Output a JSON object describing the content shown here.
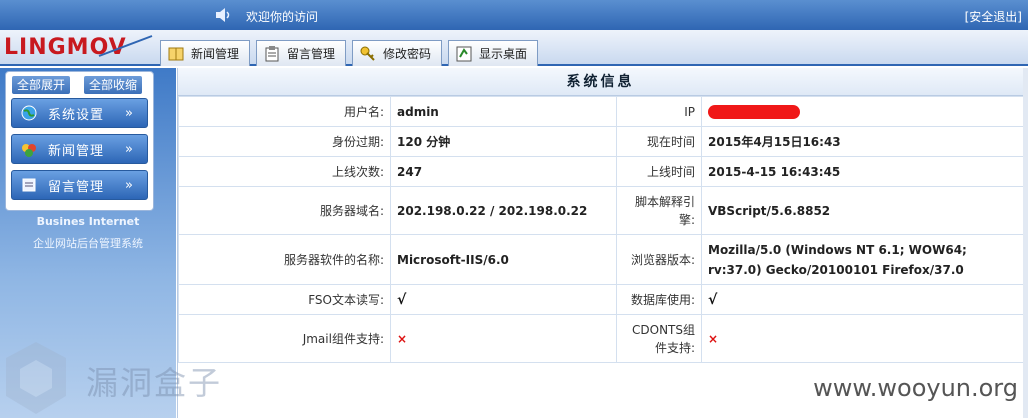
{
  "topbar": {
    "welcome": "欢迎你的访问",
    "logout": "[安全退出]"
  },
  "logo": {
    "text": "LINGMOV"
  },
  "tabs": [
    {
      "label": "新闻管理",
      "icon": "book-icon"
    },
    {
      "label": "留言管理",
      "icon": "clipboard-icon"
    },
    {
      "label": "修改密码",
      "icon": "key-icon"
    },
    {
      "label": "显示桌面",
      "icon": "desktop-icon"
    }
  ],
  "sidebar": {
    "expand_all": "全部展开",
    "collapse_all": "全部收缩",
    "menu": [
      {
        "label": "系统设置",
        "icon": "globe-icon"
      },
      {
        "label": "新闻管理",
        "icon": "news-icon"
      },
      {
        "label": "留言管理",
        "icon": "message-icon"
      }
    ],
    "brand_title": "Busines Internet",
    "brand_subtitle": "企业网站后台管理系统"
  },
  "system_info": {
    "title": "系统信息",
    "rows": [
      {
        "label": "用户名:",
        "value": "admin",
        "label2": "IP",
        "value2": ""
      },
      {
        "label": "身份过期:",
        "value": "120 分钟",
        "label2": "现在时间",
        "value2": "2015年4月15日16:43"
      },
      {
        "label": "上线次数:",
        "value": "247",
        "label2": "上线时间",
        "value2": "2015-4-15 16:43:45"
      },
      {
        "label": "服务器域名:",
        "value": "202.198.0.22 / 202.198.0.22",
        "label2": "脚本解释引擎:",
        "value2": "VBScript/5.6.8852"
      },
      {
        "label": "服务器软件的名称:",
        "value": "Microsoft-IIS/6.0",
        "label2": "浏览器版本:",
        "value2": "Mozilla/5.0 (Windows NT 6.1; WOW64; rv:37.0) Gecko/20100101 Firefox/37.0"
      },
      {
        "label": "FSO文本读写:",
        "value": "√",
        "label2": "数据库使用:",
        "value2": "√"
      },
      {
        "label": "Jmail组件支持:",
        "value": "×",
        "label2": "CDONTS组件支持:",
        "value2": "×"
      }
    ]
  },
  "watermark": {
    "left_text": "漏洞盒子",
    "right_text": "www.wooyun.org"
  },
  "colors": {
    "topbar": "#2f66b3",
    "sidebar": "#3f7ac7",
    "redaction": "#f01818",
    "cross": "#dd1111"
  }
}
